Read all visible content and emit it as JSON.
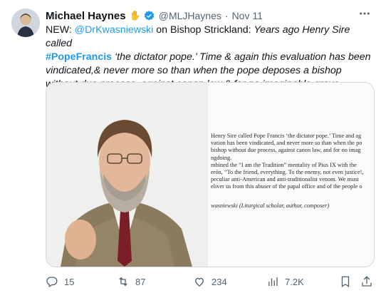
{
  "author": {
    "name": "Michael Haynes",
    "handle": "@MLJHaynes",
    "dot": "·",
    "time": "Nov 11",
    "emoji": "✋"
  },
  "tweet": {
    "part1": "NEW: ",
    "mention": "@DrKwasniewski",
    "part2": " on Bishop Strickland: ",
    "quote1": "Years ago Henry Sire called",
    "hashtag": "#PopeFrancis",
    "quote2": " ‘the dictator pope.’ Time & again this evaluation has been vindicated,& never more so than when the pope deposes a bishop without due process, against canon law,& for no imaginable grave wrongdoing"
  },
  "image": {
    "lines": [
      "Henry Sire called Pope Francis ‘the dictator pope.’ Time and ag",
      "vation has been vindicated, and never more so than when the po",
      "bishop without due process, against canon law, and for no imag",
      "ngdoing.",
      "mbined the “I am the Tradition” mentality of Pius IX with the",
      "erón, “To the friend, everything. To the enemy, not even justice!,",
      "peculiar anti-American and anti-traditionalist venom. We must",
      "eliver us from this abuser of the papal office and of the people o"
    ],
    "signature": "wasniewski (Liturgical scholar, author, composer)"
  },
  "actions": {
    "replies": "15",
    "retweets": "87",
    "likes": "234",
    "views": "7.2K"
  },
  "colors": {
    "accent": "#1d9bf0",
    "muted": "#536471",
    "text": "#0f1419"
  },
  "icons": [
    "verified-badge-icon",
    "more-icon",
    "reply-icon",
    "retweet-icon",
    "like-icon",
    "views-icon",
    "bookmark-icon",
    "share-icon"
  ]
}
